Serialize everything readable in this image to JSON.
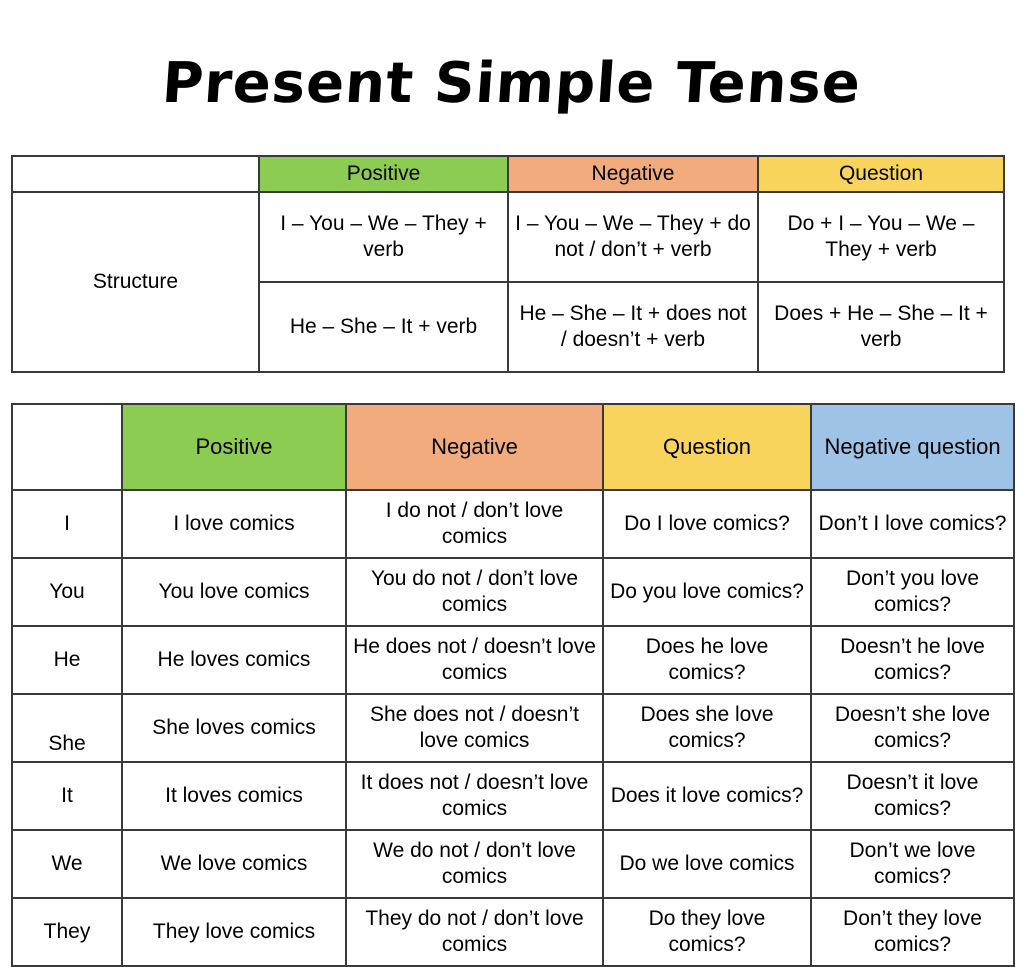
{
  "title": "Present Simple Tense",
  "colors": {
    "positive": "#8ccc52",
    "negative": "#f2ab7c",
    "question": "#f9d45c",
    "negative_question": "#9ec3e6",
    "border": "#3a3a3a",
    "text": "#000000",
    "background": "#ffffff"
  },
  "structure_table": {
    "row_label": "Structure",
    "headers": {
      "blank": "",
      "positive": "Positive",
      "negative": "Negative",
      "question": "Question"
    },
    "rows": [
      {
        "positive": "I – You – We – They + verb",
        "negative": "I – You – We – They + do not / don’t + verb",
        "question": "Do + I – You – We – They + verb"
      },
      {
        "positive": "He – She – It + verb",
        "negative": "He – She – It + does not / doesn’t + verb",
        "question": "Does + He – She – It + verb"
      }
    ]
  },
  "conjugation_table": {
    "headers": {
      "blank": "",
      "positive": "Positive",
      "negative": "Negative",
      "question": "Question",
      "negative_question": "Negative question"
    },
    "rows": [
      {
        "pronoun": "I",
        "positive": "I love comics",
        "negative": "I do not / don’t love  comics",
        "question": "Do I love comics?",
        "negative_question": "Don’t I love comics?"
      },
      {
        "pronoun": "You",
        "positive": "You love comics",
        "negative": "You do not / don’t love comics",
        "question": "Do you love comics?",
        "negative_question": "Don’t you love comics?"
      },
      {
        "pronoun": "He",
        "positive": "He loves comics",
        "negative": "He does not / doesn’t love comics",
        "question": "Does he love comics?",
        "negative_question": "Doesn’t he love comics?"
      },
      {
        "pronoun": "She",
        "positive": "She loves comics",
        "negative": "She does not / doesn’t love comics",
        "question": "Does she love comics?",
        "negative_question": "Doesn’t she love comics?"
      },
      {
        "pronoun": "It",
        "positive": "It loves comics",
        "negative": "It does not / doesn’t love comics",
        "question": "Does it love comics?",
        "negative_question": "Doesn’t it love comics?"
      },
      {
        "pronoun": "We",
        "positive": "We love comics",
        "negative": "We do not / don’t love comics",
        "question": "Do we love comics",
        "negative_question": "Don’t we love comics?"
      },
      {
        "pronoun": "They",
        "positive": "They love comics",
        "negative": "They do not / don’t love comics",
        "question": "Do they love comics?",
        "negative_question": "Don’t they love comics?"
      }
    ]
  }
}
